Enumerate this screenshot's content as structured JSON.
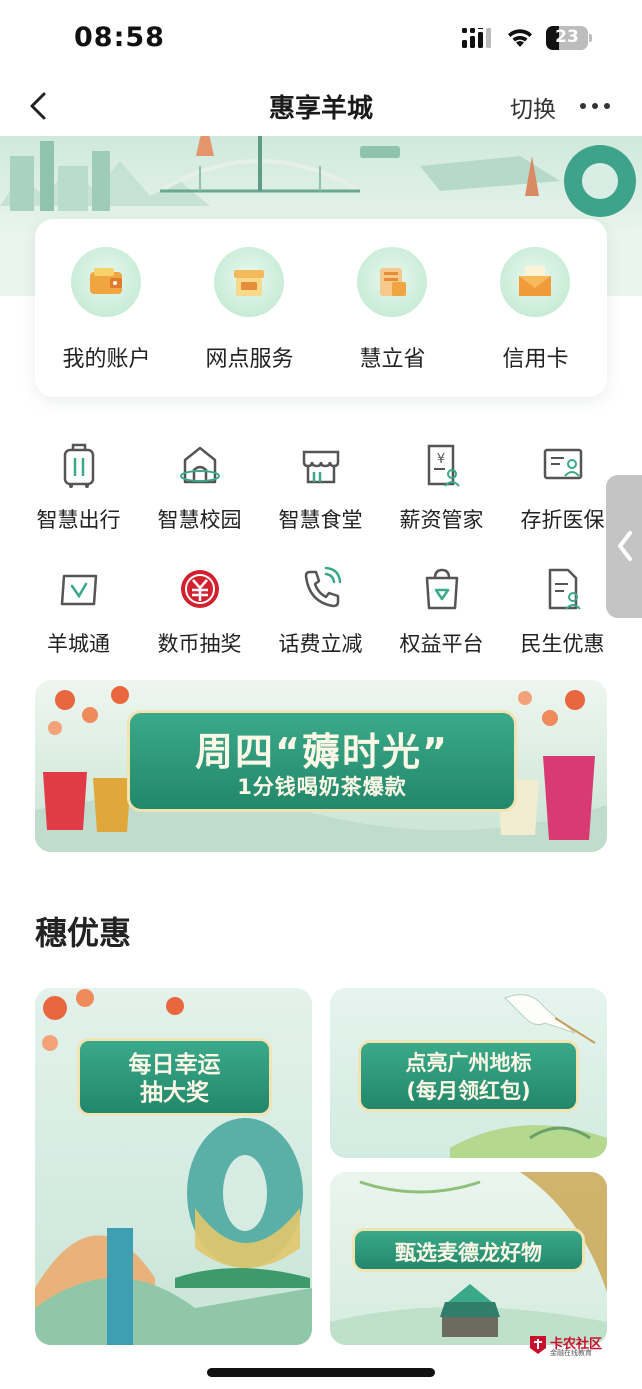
{
  "status_bar": {
    "time": "08:58",
    "battery": "23"
  },
  "nav": {
    "title": "惠享羊城",
    "switch_label": "切换"
  },
  "quick_menu": [
    {
      "label": "我的账户",
      "icon": "wallet-icon"
    },
    {
      "label": "网点服务",
      "icon": "bank-counter-icon"
    },
    {
      "label": "慧立省",
      "icon": "coupon-icon"
    },
    {
      "label": "信用卡",
      "icon": "credit-card-envelope-icon"
    }
  ],
  "services": [
    {
      "label": "智慧出行",
      "icon": "luggage-icon"
    },
    {
      "label": "智慧校园",
      "icon": "campus-icon"
    },
    {
      "label": "智慧食堂",
      "icon": "canteen-icon"
    },
    {
      "label": "薪资管家",
      "icon": "salary-doc-icon"
    },
    {
      "label": "存折医保",
      "icon": "passbook-icon"
    },
    {
      "label": "羊城通",
      "icon": "transit-card-icon"
    },
    {
      "label": "数币抽奖",
      "icon": "digital-yuan-icon"
    },
    {
      "label": "话费立减",
      "icon": "phone-icon"
    },
    {
      "label": "权益平台",
      "icon": "shopping-bag-icon"
    },
    {
      "label": "民生优惠",
      "icon": "document-user-icon"
    }
  ],
  "promo": {
    "title": "周四“薅时光”",
    "subtitle": "1分钱喝奶茶爆款"
  },
  "section": {
    "title": "穗优惠"
  },
  "offers": [
    {
      "label": "每日幸运抽大奖"
    },
    {
      "label": "点亮广州地标(每月领红包)"
    },
    {
      "label": "甄选麦德龙好物"
    }
  ],
  "watermark": {
    "text": "卡农社区",
    "sub": "金融在线教育"
  },
  "colors": {
    "brand_green": "#23876b",
    "accent_red": "#d2202f",
    "icon_gray": "#555555"
  }
}
